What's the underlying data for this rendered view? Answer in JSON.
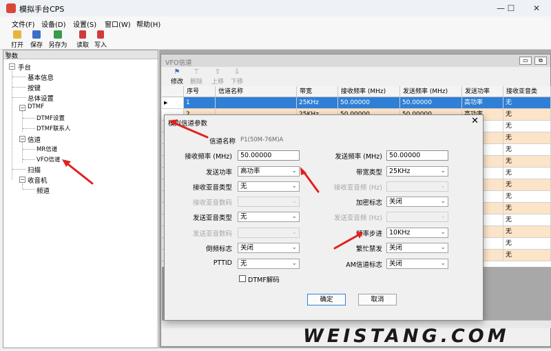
{
  "app": {
    "title": "模拟手台CPS",
    "window_controls": [
      "—",
      "☐",
      "✕"
    ]
  },
  "menu": [
    "文件(F)",
    "设备(D)",
    "设置(S)",
    "窗口(W)",
    "帮助(H)"
  ],
  "toolbar": [
    {
      "label": "打开",
      "icon": "folder-icon",
      "color": "#e8b43c"
    },
    {
      "label": "保存",
      "icon": "save-icon",
      "color": "#3b6fc9"
    },
    {
      "label": "另存为",
      "icon": "save-as-icon",
      "color": "#3a9a4a"
    },
    {
      "label": "读取",
      "icon": "read-icon",
      "color": "#d23b3b"
    },
    {
      "label": "写入",
      "icon": "write-icon",
      "color": "#d23b3b"
    }
  ],
  "params_panel": {
    "title": "参数",
    "pin": "ᵖ",
    "tree": [
      {
        "label": "手台",
        "toggle": "−"
      },
      {
        "label": "基本信息"
      },
      {
        "label": "按键"
      },
      {
        "label": "总体设置"
      },
      {
        "label": "DTMF",
        "toggle": "−"
      },
      {
        "label": "DTMF设置"
      },
      {
        "label": "DTMF联系人"
      },
      {
        "label": "信道",
        "toggle": "−"
      },
      {
        "label": "MR信道"
      },
      {
        "label": "VFO信道"
      },
      {
        "label": "扫描"
      },
      {
        "label": "收音机",
        "toggle": "−"
      },
      {
        "label": "频道"
      }
    ]
  },
  "vfo_window": {
    "title": "VFO信道",
    "mdi_buttons": [
      "▭",
      "⧉"
    ],
    "toolbar": [
      {
        "label": "修改",
        "icon": "edit-icon"
      },
      {
        "label": "删除",
        "icon": "delete-icon"
      },
      {
        "label": "上移",
        "icon": "up-icon"
      },
      {
        "label": "下移",
        "icon": "down-icon"
      }
    ],
    "columns": [
      "序号",
      "信道名称",
      "带宽",
      "接收频率 (MHz)",
      "发送频率 (MHz)",
      "发送功率",
      "接收亚音类"
    ],
    "rows": [
      {
        "indicator": "▶",
        "cells": [
          "1",
          "",
          "25KHz",
          "50.00000",
          "50.00000",
          "高功率",
          "无"
        ]
      },
      {
        "indicator": "",
        "cells": [
          "2",
          "",
          "25KHz",
          "50.00000",
          "50.00000",
          "高功率",
          "无"
        ]
      },
      {
        "indicator": "",
        "cells": [
          "",
          "",
          "",
          "",
          "",
          "",
          "无"
        ]
      },
      {
        "indicator": "",
        "cells": [
          "",
          "",
          "",
          "",
          "",
          "",
          "无"
        ]
      },
      {
        "indicator": "",
        "cells": [
          "",
          "",
          "",
          "",
          "",
          "",
          "无"
        ]
      },
      {
        "indicator": "",
        "cells": [
          "",
          "",
          "",
          "",
          "",
          "",
          "无"
        ]
      },
      {
        "indicator": "",
        "cells": [
          "",
          "",
          "",
          "",
          "",
          "",
          "无"
        ]
      },
      {
        "indicator": "",
        "cells": [
          "",
          "",
          "",
          "",
          "",
          "",
          "无"
        ]
      },
      {
        "indicator": "",
        "cells": [
          "",
          "",
          "",
          "",
          "",
          "",
          "无"
        ]
      },
      {
        "indicator": "",
        "cells": [
          "",
          "",
          "",
          "",
          "",
          "",
          "无"
        ]
      },
      {
        "indicator": "",
        "cells": [
          "",
          "",
          "",
          "",
          "",
          "",
          "无"
        ]
      },
      {
        "indicator": "",
        "cells": [
          "",
          "",
          "",
          "",
          "",
          "",
          "无"
        ]
      },
      {
        "indicator": "",
        "cells": [
          "",
          "",
          "",
          "",
          "",
          "",
          "无"
        ]
      },
      {
        "indicator": "",
        "cells": [
          "",
          "",
          "",
          "",
          "",
          "",
          "无"
        ]
      }
    ]
  },
  "dialog": {
    "title": "模拟信道参数",
    "close": "✕",
    "channel_name": {
      "label": "信道名称",
      "value": "P1(50M-76M)A"
    },
    "left": [
      {
        "label": "接收频率 (MHz)",
        "kind": "input",
        "value": "50.00000",
        "enabled": true
      },
      {
        "label": "发送功率",
        "kind": "select",
        "value": "高功率",
        "enabled": true
      },
      {
        "label": "接收亚音类型",
        "kind": "select",
        "value": "无",
        "enabled": true
      },
      {
        "label": "接收亚音数码",
        "kind": "select",
        "value": "",
        "enabled": false
      },
      {
        "label": "发送亚音类型",
        "kind": "select",
        "value": "无",
        "enabled": true
      },
      {
        "label": "发送亚音数码",
        "kind": "select",
        "value": "",
        "enabled": false
      },
      {
        "label": "倒频标志",
        "kind": "select",
        "value": "关闭",
        "enabled": true
      },
      {
        "label": "PTTID",
        "kind": "select",
        "value": "无",
        "enabled": true
      }
    ],
    "right": [
      {
        "label": "发送频率 (MHz)",
        "kind": "input",
        "value": "50.00000",
        "enabled": true
      },
      {
        "label": "带宽类型",
        "kind": "select",
        "value": "25KHz",
        "enabled": true
      },
      {
        "label": "接收亚音频 (Hz)",
        "kind": "select",
        "value": "",
        "enabled": false
      },
      {
        "label": "加密标志",
        "kind": "select",
        "value": "关闭",
        "enabled": true
      },
      {
        "label": "发送亚音频 (Hz)",
        "kind": "select",
        "value": "",
        "enabled": false
      },
      {
        "label": "频率步进",
        "kind": "select",
        "value": "10KHz",
        "enabled": true
      },
      {
        "label": "繁忙禁发",
        "kind": "select",
        "value": "关闭",
        "enabled": true
      },
      {
        "label": "AM信道标志",
        "kind": "select",
        "value": "关闭",
        "enabled": true
      }
    ],
    "dtmf_decode": {
      "label": "DTMF解码",
      "checked": false
    },
    "ok_label": "确定",
    "cancel_label": "取消"
  },
  "watermark": "WEISTANG.COM",
  "colors": {
    "selection": "#2f7fd6",
    "row_alt": "#fce4c8",
    "annotation_arrow": "#e02020"
  }
}
